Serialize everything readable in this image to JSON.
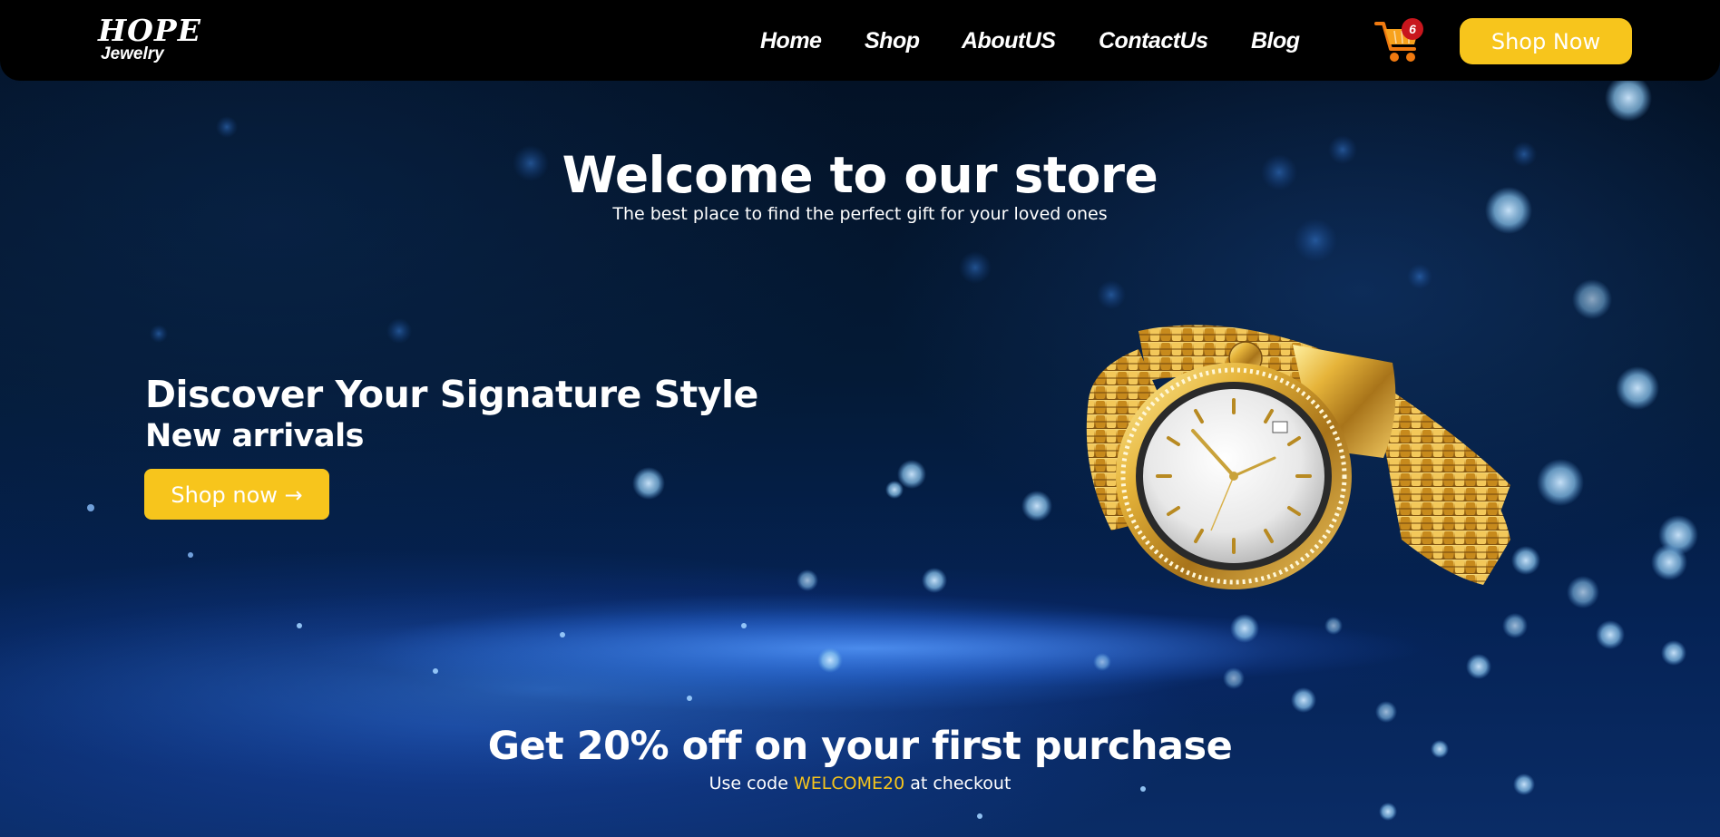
{
  "navbar": {
    "logo_top": "HOPE",
    "logo_bottom": "Jewelry",
    "links": [
      "Home",
      "Shop",
      "AboutUS",
      "ContactUs",
      "Blog"
    ],
    "cart_count": "6",
    "cart_icon": "shopping-cart-icon",
    "cta_label": "Shop Now"
  },
  "hero": {
    "title": "Welcome to our store",
    "subtitle": "The best place to find the perfect gift for your loved ones",
    "feature_title": "Discover Your Signature Style",
    "feature_subtitle": "New arrivals",
    "cta_label": "Shop now →",
    "product_image": "gold-watch-image"
  },
  "promo": {
    "title": "Get 20% off on your first purchase",
    "prefix": "Use code ",
    "code": "WELCOME20",
    "suffix": " at checkout"
  },
  "colors": {
    "accent": "#f7c51c",
    "navbar": "#000000",
    "badge": "#c8161d",
    "background": "#041a36"
  }
}
